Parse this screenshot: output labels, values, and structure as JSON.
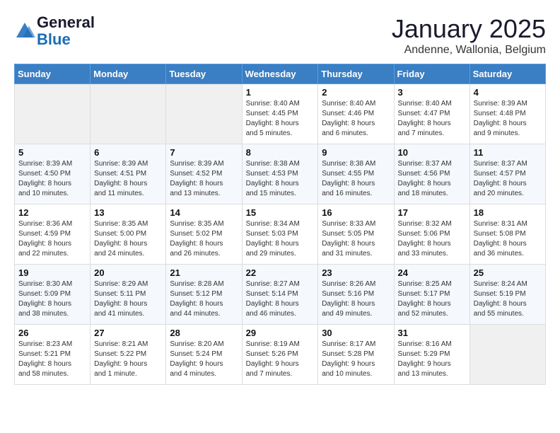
{
  "header": {
    "logo_text_general": "General",
    "logo_text_blue": "Blue",
    "month_title": "January 2025",
    "location": "Andenne, Wallonia, Belgium"
  },
  "days_of_week": [
    "Sunday",
    "Monday",
    "Tuesday",
    "Wednesday",
    "Thursday",
    "Friday",
    "Saturday"
  ],
  "weeks": [
    [
      {
        "day": "",
        "info": ""
      },
      {
        "day": "",
        "info": ""
      },
      {
        "day": "",
        "info": ""
      },
      {
        "day": "1",
        "info": "Sunrise: 8:40 AM\nSunset: 4:45 PM\nDaylight: 8 hours\nand 5 minutes."
      },
      {
        "day": "2",
        "info": "Sunrise: 8:40 AM\nSunset: 4:46 PM\nDaylight: 8 hours\nand 6 minutes."
      },
      {
        "day": "3",
        "info": "Sunrise: 8:40 AM\nSunset: 4:47 PM\nDaylight: 8 hours\nand 7 minutes."
      },
      {
        "day": "4",
        "info": "Sunrise: 8:39 AM\nSunset: 4:48 PM\nDaylight: 8 hours\nand 9 minutes."
      }
    ],
    [
      {
        "day": "5",
        "info": "Sunrise: 8:39 AM\nSunset: 4:50 PM\nDaylight: 8 hours\nand 10 minutes."
      },
      {
        "day": "6",
        "info": "Sunrise: 8:39 AM\nSunset: 4:51 PM\nDaylight: 8 hours\nand 11 minutes."
      },
      {
        "day": "7",
        "info": "Sunrise: 8:39 AM\nSunset: 4:52 PM\nDaylight: 8 hours\nand 13 minutes."
      },
      {
        "day": "8",
        "info": "Sunrise: 8:38 AM\nSunset: 4:53 PM\nDaylight: 8 hours\nand 15 minutes."
      },
      {
        "day": "9",
        "info": "Sunrise: 8:38 AM\nSunset: 4:55 PM\nDaylight: 8 hours\nand 16 minutes."
      },
      {
        "day": "10",
        "info": "Sunrise: 8:37 AM\nSunset: 4:56 PM\nDaylight: 8 hours\nand 18 minutes."
      },
      {
        "day": "11",
        "info": "Sunrise: 8:37 AM\nSunset: 4:57 PM\nDaylight: 8 hours\nand 20 minutes."
      }
    ],
    [
      {
        "day": "12",
        "info": "Sunrise: 8:36 AM\nSunset: 4:59 PM\nDaylight: 8 hours\nand 22 minutes."
      },
      {
        "day": "13",
        "info": "Sunrise: 8:35 AM\nSunset: 5:00 PM\nDaylight: 8 hours\nand 24 minutes."
      },
      {
        "day": "14",
        "info": "Sunrise: 8:35 AM\nSunset: 5:02 PM\nDaylight: 8 hours\nand 26 minutes."
      },
      {
        "day": "15",
        "info": "Sunrise: 8:34 AM\nSunset: 5:03 PM\nDaylight: 8 hours\nand 29 minutes."
      },
      {
        "day": "16",
        "info": "Sunrise: 8:33 AM\nSunset: 5:05 PM\nDaylight: 8 hours\nand 31 minutes."
      },
      {
        "day": "17",
        "info": "Sunrise: 8:32 AM\nSunset: 5:06 PM\nDaylight: 8 hours\nand 33 minutes."
      },
      {
        "day": "18",
        "info": "Sunrise: 8:31 AM\nSunset: 5:08 PM\nDaylight: 8 hours\nand 36 minutes."
      }
    ],
    [
      {
        "day": "19",
        "info": "Sunrise: 8:30 AM\nSunset: 5:09 PM\nDaylight: 8 hours\nand 38 minutes."
      },
      {
        "day": "20",
        "info": "Sunrise: 8:29 AM\nSunset: 5:11 PM\nDaylight: 8 hours\nand 41 minutes."
      },
      {
        "day": "21",
        "info": "Sunrise: 8:28 AM\nSunset: 5:12 PM\nDaylight: 8 hours\nand 44 minutes."
      },
      {
        "day": "22",
        "info": "Sunrise: 8:27 AM\nSunset: 5:14 PM\nDaylight: 8 hours\nand 46 minutes."
      },
      {
        "day": "23",
        "info": "Sunrise: 8:26 AM\nSunset: 5:16 PM\nDaylight: 8 hours\nand 49 minutes."
      },
      {
        "day": "24",
        "info": "Sunrise: 8:25 AM\nSunset: 5:17 PM\nDaylight: 8 hours\nand 52 minutes."
      },
      {
        "day": "25",
        "info": "Sunrise: 8:24 AM\nSunset: 5:19 PM\nDaylight: 8 hours\nand 55 minutes."
      }
    ],
    [
      {
        "day": "26",
        "info": "Sunrise: 8:23 AM\nSunset: 5:21 PM\nDaylight: 8 hours\nand 58 minutes."
      },
      {
        "day": "27",
        "info": "Sunrise: 8:21 AM\nSunset: 5:22 PM\nDaylight: 9 hours\nand 1 minute."
      },
      {
        "day": "28",
        "info": "Sunrise: 8:20 AM\nSunset: 5:24 PM\nDaylight: 9 hours\nand 4 minutes."
      },
      {
        "day": "29",
        "info": "Sunrise: 8:19 AM\nSunset: 5:26 PM\nDaylight: 9 hours\nand 7 minutes."
      },
      {
        "day": "30",
        "info": "Sunrise: 8:17 AM\nSunset: 5:28 PM\nDaylight: 9 hours\nand 10 minutes."
      },
      {
        "day": "31",
        "info": "Sunrise: 8:16 AM\nSunset: 5:29 PM\nDaylight: 9 hours\nand 13 minutes."
      },
      {
        "day": "",
        "info": ""
      }
    ]
  ]
}
